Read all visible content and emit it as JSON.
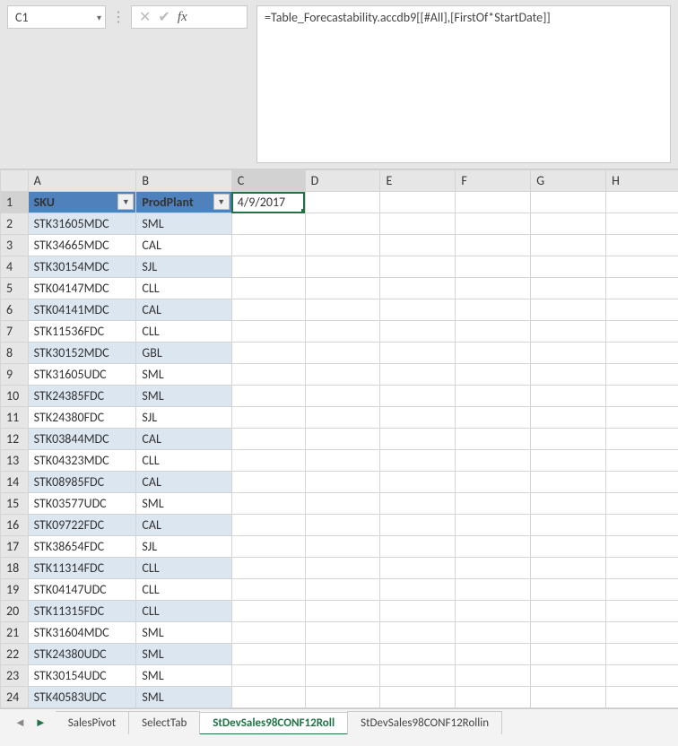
{
  "name_box": {
    "value": "C1"
  },
  "formula_bar": {
    "value": "=Table_Forecastability.accdb9[[#All],[FirstOf*StartDate]]"
  },
  "columns": [
    "A",
    "B",
    "C",
    "D",
    "E",
    "F",
    "G",
    "H"
  ],
  "selected_col": "C",
  "selected_row": 1,
  "header": {
    "sku": "SKU",
    "prodplant": "ProdPlant"
  },
  "c1_value": "4/9/2017",
  "rows": [
    {
      "sku": "STK31605MDC",
      "plant": "SML"
    },
    {
      "sku": "STK34665MDC",
      "plant": "CAL"
    },
    {
      "sku": "STK30154MDC",
      "plant": "SJL"
    },
    {
      "sku": "STK04147MDC",
      "plant": "CLL"
    },
    {
      "sku": "STK04141MDC",
      "plant": "CAL"
    },
    {
      "sku": "STK11536FDC",
      "plant": "CLL"
    },
    {
      "sku": "STK30152MDC",
      "plant": "GBL"
    },
    {
      "sku": "STK31605UDC",
      "plant": "SML"
    },
    {
      "sku": "STK24385FDC",
      "plant": "SML"
    },
    {
      "sku": "STK24380FDC",
      "plant": "SJL"
    },
    {
      "sku": "STK03844MDC",
      "plant": "CAL"
    },
    {
      "sku": "STK04323MDC",
      "plant": "CLL"
    },
    {
      "sku": "STK08985FDC",
      "plant": "CAL"
    },
    {
      "sku": "STK03577UDC",
      "plant": "SML"
    },
    {
      "sku": "STK09722FDC",
      "plant": "CAL"
    },
    {
      "sku": "STK38654FDC",
      "plant": "SJL"
    },
    {
      "sku": "STK11314FDC",
      "plant": "CLL"
    },
    {
      "sku": "STK04147UDC",
      "plant": "CLL"
    },
    {
      "sku": "STK11315FDC",
      "plant": "CLL"
    },
    {
      "sku": "STK31604MDC",
      "plant": "SML"
    },
    {
      "sku": "STK24380UDC",
      "plant": "SML"
    },
    {
      "sku": "STK30154UDC",
      "plant": "SML"
    },
    {
      "sku": "STK40583UDC",
      "plant": "SML"
    }
  ],
  "tabs": {
    "items": [
      "SalesPivot",
      "SelectTab",
      "StDevSales98CONF12Roll",
      "StDevSales98CONF12Rollin"
    ],
    "active": 2
  }
}
